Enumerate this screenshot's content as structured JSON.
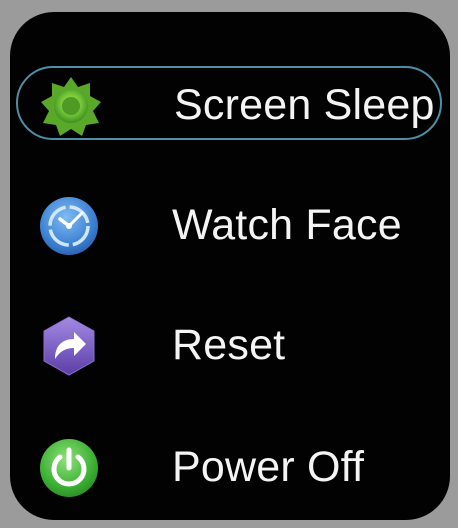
{
  "menu": {
    "items": [
      {
        "label": "Screen Sleep",
        "icon": "sun-icon",
        "selected": true,
        "icon_color": "#6fbf3a"
      },
      {
        "label": "Watch Face",
        "icon": "clock-icon",
        "selected": false,
        "icon_color": "#3f86d6"
      },
      {
        "label": "Reset",
        "icon": "reset-arrow-icon",
        "selected": false,
        "icon_color": "#7a57c2"
      },
      {
        "label": "Power Off",
        "icon": "power-icon",
        "selected": false,
        "icon_color": "#46b63c"
      }
    ],
    "selection_outline_color": "#4f8fa6"
  }
}
